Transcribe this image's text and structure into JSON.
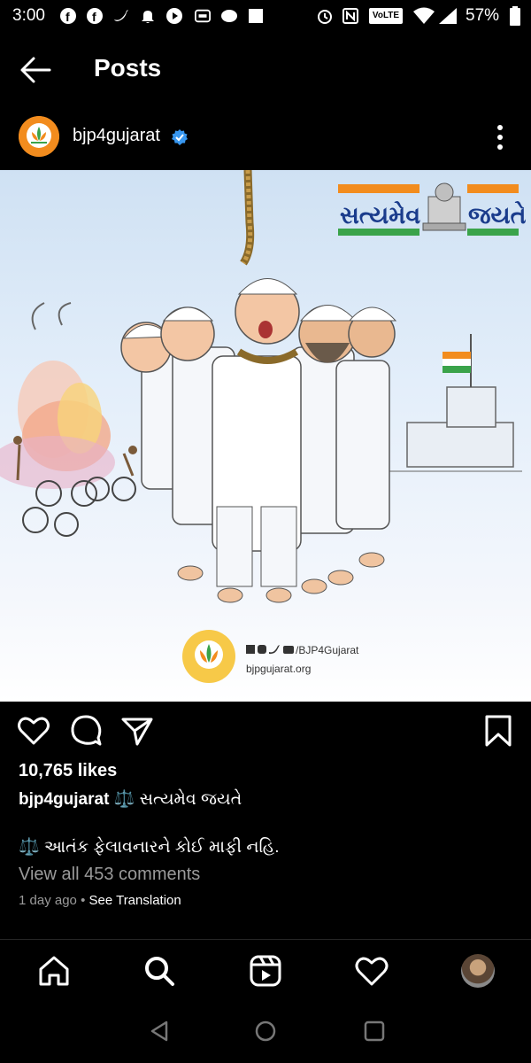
{
  "status_bar": {
    "time": "3:00",
    "network": "VoLTE",
    "battery": "57%"
  },
  "header": {
    "title": "Posts"
  },
  "post": {
    "username": "bjp4gujarat",
    "image": {
      "banner_left": "સત્યમેવ",
      "banner_right": "જયતે",
      "social_handle": "/BJP4Gujarat",
      "website": "bjpgujarat.org"
    },
    "likes": "10,765 likes",
    "caption_user": "bjp4gujarat",
    "caption_text": "⚖️ સત્યમેવ જયતે",
    "caption_line2": "⚖️ આતંક ફેલાવનારને કોઈ માફી નહિ.",
    "view_comments": "View all 453 comments",
    "time_ago": "1 day ago",
    "separator": "•",
    "see_translation": "See Translation"
  },
  "colors": {
    "background": "#000000",
    "secondary_text": "#9a9a9a",
    "verified": "#3897f0",
    "saffron": "#f28c1e"
  }
}
